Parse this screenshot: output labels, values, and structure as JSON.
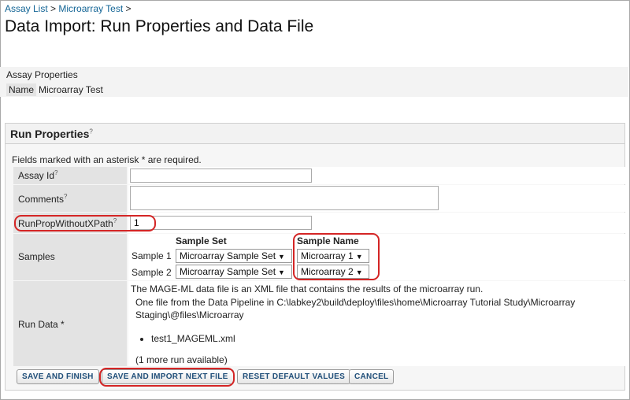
{
  "breadcrumbs": [
    {
      "label": "Assay List"
    },
    {
      "label": "Microarray Test"
    }
  ],
  "breadcrumb_separator": ">",
  "page_title": "Data Import: Run Properties and Data File",
  "assay_properties": {
    "heading": "Assay Properties",
    "name_label": "Name",
    "name_value": "Microarray Test"
  },
  "run_properties": {
    "heading": "Run Properties",
    "help_mark": "?",
    "required_note": "Fields marked with an asterisk * are required.",
    "fields": {
      "assay_id": {
        "label": "Assay Id",
        "value": ""
      },
      "comments": {
        "label": "Comments",
        "value": ""
      },
      "run_prop": {
        "label": "RunPropWithoutXPath",
        "value": "1"
      }
    },
    "samples": {
      "label": "Samples",
      "col_sample_set": "Sample Set",
      "col_sample_name": "Sample Name",
      "rows": [
        {
          "label": "Sample 1",
          "sample_set": "Microarray Sample Set",
          "sample_name": "Microarray 1"
        },
        {
          "label": "Sample 2",
          "sample_set": "Microarray Sample Set",
          "sample_name": "Microarray 2"
        }
      ]
    },
    "run_data": {
      "label": "Run Data *",
      "description": "The MAGE-ML data file is an XML file that contains the results of the microarray run.",
      "pipeline_line1": "One file from the Data Pipeline in C:\\labkey2\\build\\deploy\\files\\home\\Microarray Tutorial Study\\Microarray",
      "pipeline_line2": "Staging\\@files\\Microarray",
      "files": [
        "test1_MAGEML.xml"
      ],
      "more_runs": "(1 more run available)"
    }
  },
  "buttons": {
    "save_finish": "SAVE AND FINISH",
    "save_import_next": "SAVE AND IMPORT NEXT FILE",
    "reset_defaults": "RESET DEFAULT VALUES",
    "cancel": "CANCEL"
  },
  "colors": {
    "link": "#126495",
    "highlight_ring": "#d42525",
    "button_text": "#1f4e79"
  }
}
